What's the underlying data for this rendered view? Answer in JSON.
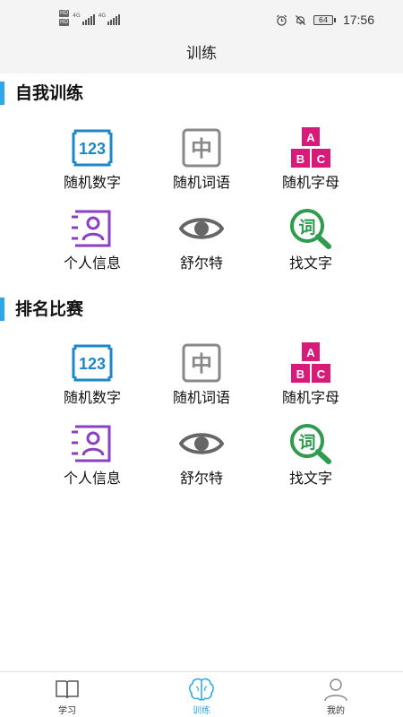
{
  "status_bar": {
    "sim1": "HD",
    "sim2": "HD",
    "net1": "4G",
    "net2": "4G",
    "battery": "64",
    "time": "17:56",
    "icons": [
      "alarm-icon",
      "mute-icon",
      "battery-icon"
    ]
  },
  "header": {
    "title": "训练"
  },
  "sections": [
    {
      "title": "自我训练",
      "items": [
        {
          "label": "随机数字",
          "icon": "number-123-icon",
          "glyph": "123"
        },
        {
          "label": "随机词语",
          "icon": "chinese-char-icon",
          "glyph": "中"
        },
        {
          "label": "随机字母",
          "icon": "abc-blocks-icon",
          "glyph_a": "A",
          "glyph_b": "B",
          "glyph_c": "C"
        },
        {
          "label": "个人信息",
          "icon": "contact-card-icon"
        },
        {
          "label": "舒尔特",
          "icon": "eye-icon"
        },
        {
          "label": "找文字",
          "icon": "search-word-icon",
          "glyph": "词"
        }
      ]
    },
    {
      "title": "排名比赛",
      "items": [
        {
          "label": "随机数字",
          "icon": "number-123-icon",
          "glyph": "123"
        },
        {
          "label": "随机词语",
          "icon": "chinese-char-icon",
          "glyph": "中"
        },
        {
          "label": "随机字母",
          "icon": "abc-blocks-icon",
          "glyph_a": "A",
          "glyph_b": "B",
          "glyph_c": "C"
        },
        {
          "label": "个人信息",
          "icon": "contact-card-icon"
        },
        {
          "label": "舒尔特",
          "icon": "eye-icon"
        },
        {
          "label": "找文字",
          "icon": "search-word-icon",
          "glyph": "词"
        }
      ]
    }
  ],
  "bottom_nav": [
    {
      "label": "学习",
      "icon": "book-icon",
      "active": false
    },
    {
      "label": "训练",
      "icon": "brain-icon",
      "active": true
    },
    {
      "label": "我的",
      "icon": "user-icon",
      "active": false
    }
  ],
  "colors": {
    "accent": "#2ea7e8",
    "number_icon": "#1e88c7",
    "char_icon": "#888888",
    "abc_icon": "#d81b7a",
    "card_icon": "#8a3fc4",
    "eye_icon": "#666666",
    "search_icon": "#2e9b4e"
  }
}
